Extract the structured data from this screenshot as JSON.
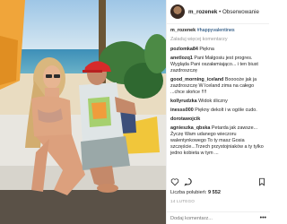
{
  "header": {
    "username": "m_rozenek",
    "separator": "•",
    "follow_label": "Obserwowanie"
  },
  "caption": {
    "username": "m_rozenek",
    "hashtags": "#happyvalentines"
  },
  "load_more_label": "Załaduj więcej komentarzy",
  "comments": [
    {
      "user": "pozlomka84",
      "text": "Piękna"
    },
    {
      "user": "anetlozq1",
      "text": "Pani Małgosiu jest progres. Wygląda Pani oszałamiająco... i ten biust zazdroszczę"
    },
    {
      "user": "good_morning_iceland",
      "text": "Booooże jak ja zazdroszczę W Iceland zima na całego ...chce słońce !!!!"
    },
    {
      "user": "kollyrudzka",
      "text": "Widok śliczny"
    },
    {
      "user": "inesss000",
      "text": "Piękny dekolt i w ogóle cudo."
    },
    {
      "user": "dorotawojcik",
      "text": ""
    },
    {
      "user": "agnieszka_qbska",
      "text": "Petarda jak zawsze... Życzę Wam udanego wieczoru walentynkowego To ty masz Gosia szczęście...Trzech przystojniaków a ty tylko jedno kobieta w tym ..."
    }
  ],
  "likes": {
    "label": "Liczba polubień:",
    "count": "9 552"
  },
  "date": "14 LUTEGO",
  "comment_input": {
    "placeholder": "Dodaj komentarz..."
  },
  "icons": [
    "heart-icon",
    "comment-icon",
    "bookmark-icon",
    "more-icon"
  ],
  "colors": {
    "link": "#003569",
    "muted": "#999999",
    "text": "#262626"
  }
}
